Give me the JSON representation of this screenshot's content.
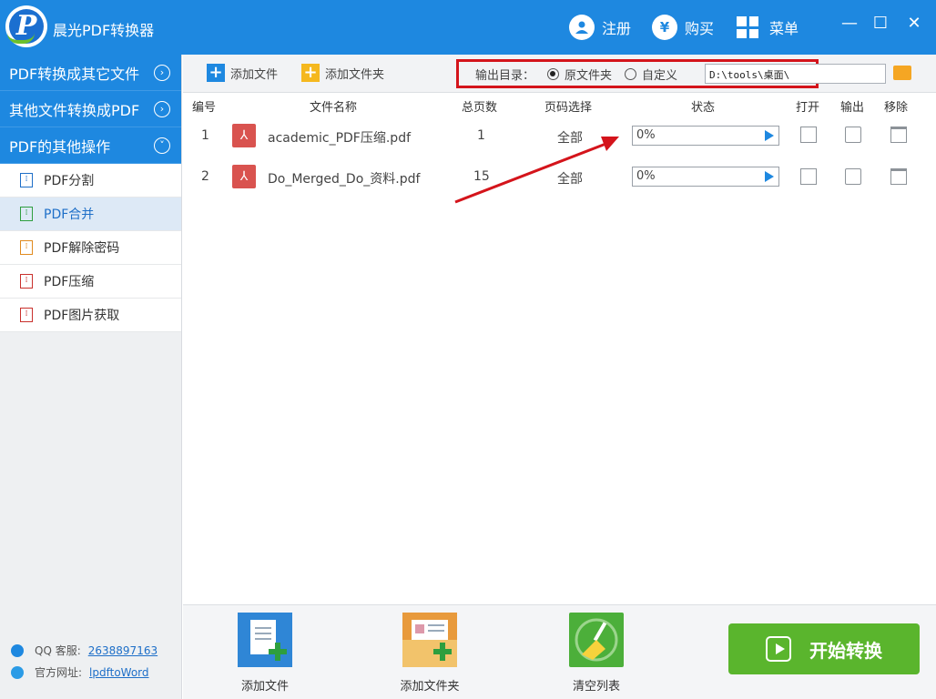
{
  "titlebar": {
    "logo_letter": "P",
    "title": "晨光PDF转换器",
    "register_label": "注册",
    "buy_label": "购买",
    "menu_label": "菜单",
    "minimize": "—",
    "maximize": "☐",
    "close": "✕"
  },
  "sidebar": {
    "categories": [
      {
        "label": "PDF转换成其它文件",
        "chevron": "›"
      },
      {
        "label": "其他文件转换成PDF",
        "chevron": "›"
      },
      {
        "label": "PDF的其他操作",
        "chevron": "˅"
      }
    ],
    "items": [
      {
        "label": "PDF分割"
      },
      {
        "label": "PDF合并"
      },
      {
        "label": "PDF解除密码"
      },
      {
        "label": "PDF压缩"
      },
      {
        "label": "PDF图片获取"
      }
    ],
    "qq_label": "QQ 客服:",
    "qq_value": "2638897163",
    "site_label": "官方网址:",
    "site_value": "lpdftoWord"
  },
  "toolbar": {
    "add_file": "添加文件",
    "add_folder": "添加文件夹",
    "output_label": "输出目录：",
    "option_source": "原文件夹",
    "option_custom": "自定义",
    "path": "D:\\tools\\桌面\\"
  },
  "table": {
    "headers": [
      "编号",
      "文件名称",
      "总页数",
      "页码选择",
      "状态",
      "打开",
      "输出",
      "移除"
    ],
    "rows": [
      {
        "index": "1",
        "name": "academic_PDF压缩.pdf",
        "pages": "1",
        "range": "全部",
        "status": "0%"
      },
      {
        "index": "2",
        "name": "Do_Merged_Do_资料.pdf",
        "pages": "15",
        "range": "全部",
        "status": "0%"
      }
    ]
  },
  "bottom": {
    "add_file": "添加文件",
    "add_folder": "添加文件夹",
    "clear_list": "清空列表",
    "start": "开始转换"
  },
  "colors": {
    "primary": "#1e88e0",
    "highlight_box": "#d4141b",
    "start_button": "#5ab52d"
  }
}
